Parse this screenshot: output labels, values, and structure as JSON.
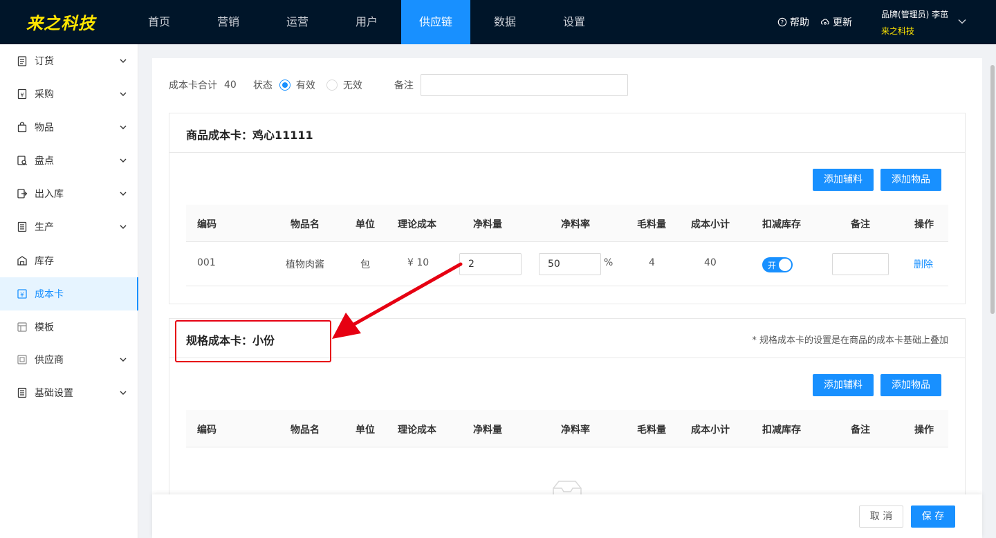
{
  "brand": {
    "logo_text": "来之科技",
    "logo_color": "#ffe600"
  },
  "nav": {
    "items": [
      {
        "label": "首页"
      },
      {
        "label": "营销"
      },
      {
        "label": "运营"
      },
      {
        "label": "用户"
      },
      {
        "label": "供应链"
      },
      {
        "label": "数据"
      },
      {
        "label": "设置"
      }
    ],
    "help_label": "帮助",
    "update_label": "更新",
    "user_name": "品牌(管理员)   李茁",
    "user_company": "来之科技"
  },
  "sidebar": {
    "items": [
      {
        "label": "订货",
        "icon": "clipboard-icon"
      },
      {
        "label": "采购",
        "icon": "purchase-icon"
      },
      {
        "label": "物品",
        "icon": "bag-icon"
      },
      {
        "label": "盘点",
        "icon": "inventory-check-icon"
      },
      {
        "label": "出入库",
        "icon": "in-out-icon"
      },
      {
        "label": "生产",
        "icon": "production-icon"
      },
      {
        "label": "库存",
        "icon": "warehouse-icon"
      },
      {
        "label": "成本卡",
        "icon": "cost-card-icon"
      },
      {
        "label": "模板",
        "icon": "template-icon"
      },
      {
        "label": "供应商",
        "icon": "supplier-icon"
      },
      {
        "label": "基础设置",
        "icon": "settings-list-icon"
      }
    ]
  },
  "filters": {
    "total_label": "成本卡合计",
    "total_value": "40",
    "status_label": "状态",
    "status_valid": "有效",
    "status_invalid": "无效",
    "remark_label": "备注",
    "remark_value": ""
  },
  "product_card": {
    "title": "商品成本卡：鸡心11111",
    "add_aux_label": "添加辅料",
    "add_item_label": "添加物品",
    "columns": [
      "编码",
      "物品名",
      "单位",
      "理论成本",
      "净料量",
      "净料率",
      "毛料量",
      "成本小计",
      "扣减库存",
      "备注",
      "操作"
    ],
    "rows": [
      {
        "code": "001",
        "name": "植物肉酱",
        "unit": "包",
        "theory_cost": "¥ 10",
        "net_qty": "2",
        "net_rate": "50",
        "rate_unit": "%",
        "gross_qty": "4",
        "subtotal": "40",
        "deduct_switch_text": "开",
        "remark": "",
        "action": "删除"
      }
    ]
  },
  "spec_card": {
    "title": "规格成本卡：小份",
    "note": "* 规格成本卡的设置是在商品的成本卡基础上叠加",
    "add_aux_label": "添加辅料",
    "add_item_label": "添加物品",
    "columns": [
      "编码",
      "物品名",
      "单位",
      "理论成本",
      "净料量",
      "净料率",
      "毛料量",
      "成本小计",
      "扣减库存",
      "备注",
      "操作"
    ]
  },
  "footer": {
    "cancel_label": "取 消",
    "save_label": "保 存"
  },
  "colors": {
    "primary": "#1890ff",
    "topbar": "#001529",
    "annotation": "#e60012"
  }
}
